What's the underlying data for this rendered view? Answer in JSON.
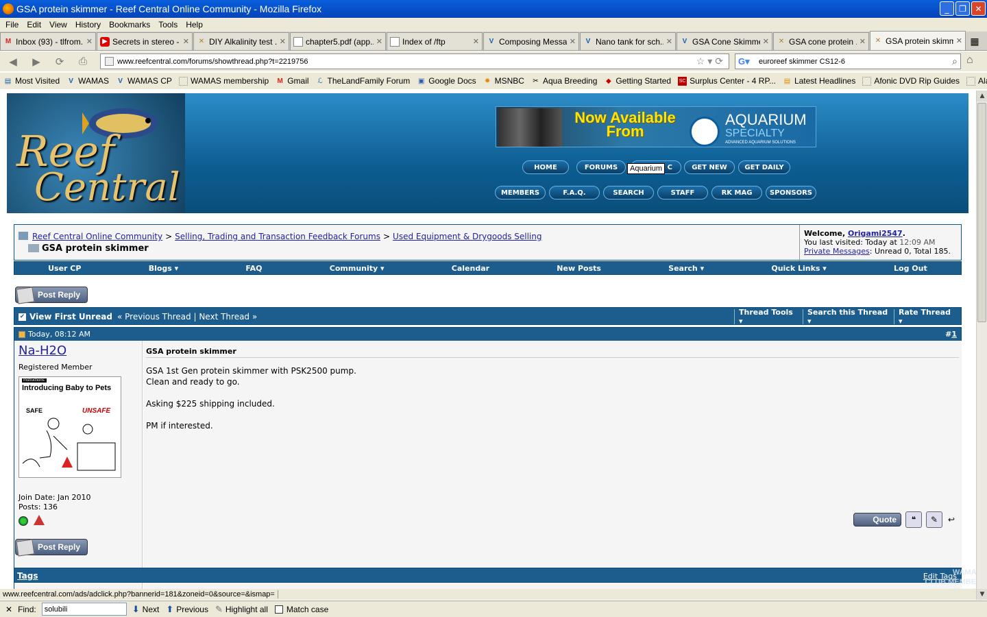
{
  "window": {
    "title": "GSA protein skimmer - Reef Central Online Community - Mozilla Firefox"
  },
  "menu": [
    "File",
    "Edit",
    "View",
    "History",
    "Bookmarks",
    "Tools",
    "Help"
  ],
  "tabs": [
    {
      "label": "Inbox (93) - tlfrom...",
      "icon": "gmail-icon"
    },
    {
      "label": "Secrets in stereo - ...",
      "icon": "youtube-icon"
    },
    {
      "label": "DIY Alkalinity test ...",
      "icon": "reefcentral-icon"
    },
    {
      "label": "chapter5.pdf (app...",
      "icon": "page-icon"
    },
    {
      "label": "Index of /ftp",
      "icon": "page-icon"
    },
    {
      "label": "Composing Message",
      "icon": "wamas-icon"
    },
    {
      "label": "Nano tank for sch...",
      "icon": "wamas-icon"
    },
    {
      "label": "GSA Cone Skimme...",
      "icon": "wamas-icon"
    },
    {
      "label": "GSA cone protein ...",
      "icon": "reefcentral-icon"
    },
    {
      "label": "GSA protein skimm...",
      "icon": "reefcentral-icon"
    }
  ],
  "nav": {
    "url": "www.reefcentral.com/forums/showthread.php?t=2219756",
    "search": "euroreef  skimmer CS12-6"
  },
  "bookmarks": [
    {
      "label": "Most Visited"
    },
    {
      "label": "WAMAS"
    },
    {
      "label": "WAMAS CP"
    },
    {
      "label": "WAMAS membership"
    },
    {
      "label": "Gmail"
    },
    {
      "label": "TheLandFamily Forum"
    },
    {
      "label": "Google Docs"
    },
    {
      "label": "MSNBC"
    },
    {
      "label": "Aqua Breeding"
    },
    {
      "label": "Getting Started"
    },
    {
      "label": "Surplus Center - 4 RP..."
    },
    {
      "label": "Latest Headlines"
    },
    {
      "label": "Afonic DVD Rip Guides"
    },
    {
      "label": "Alarms, keyless, start..."
    }
  ],
  "header": {
    "logo_line1": "Reef",
    "logo_line2": "Central",
    "banner": {
      "headline": "Now Available From",
      "brand": "AQUARIUM",
      "brand2": "SPECIALTY",
      "tagline": "ADVANCED AQUARIUM SOLUTIONS"
    },
    "buttons_row1": [
      "HOME",
      "FORUMS",
      "C",
      "GET NEW",
      "GET DAILY"
    ],
    "buttons_row2": [
      "MEMBERS",
      "F.A.Q.",
      "SEARCH",
      "STAFF",
      "RK MAG",
      "SPONSORS"
    ],
    "tooltip": "Aquarium"
  },
  "breadcrumb": {
    "items": [
      "Reef Central Online Community",
      "Selling, Trading and Transaction Feedback Forums",
      "Used Equipment & Drygoods Selling"
    ],
    "sep": ">",
    "thread_title": "GSA protein skimmer"
  },
  "welcome": {
    "prefix": "Welcome,",
    "user": "Origami2547",
    "last_visit_prefix": "You last visited: Today at",
    "last_visit_time": "12:09 AM",
    "pm_link": "Private Messages",
    "pm_status": ": Unread 0, Total 185."
  },
  "navrow": [
    "User CP",
    "Blogs ▾",
    "FAQ",
    "Community ▾",
    "Calendar",
    "New Posts",
    "Search ▾",
    "Quick Links ▾",
    "Log Out"
  ],
  "post_reply": "Post Reply",
  "thread_bar": {
    "view_first_unread": "View First Unread",
    "prev_next": "« Previous Thread | Next Thread »",
    "tools": [
      "Thread Tools ▾",
      "Search this Thread ▾",
      "Rate Thread ▾"
    ]
  },
  "post": {
    "date": "Today, 08:12 AM",
    "number": "1",
    "number_prefix": "#",
    "username": "Na-H2O",
    "user_title": "Registered Member",
    "avatar": {
      "label": "Instructions:",
      "title": "Introducing Baby to Pets",
      "safe": "SAFE",
      "unsafe": "UNSAFE"
    },
    "join_date": "Join Date: Jan 2010",
    "posts": "Posts: 136",
    "title": "GSA protein skimmer",
    "body": "GSA 1st Gen protein skimmer with PSK2500 pump.\nClean and ready to go.\n\nAsking $225 shipping included.\n\nPM if interested.",
    "quote": "Quote"
  },
  "tags": {
    "label": "Tags",
    "edit": "Edit Tags"
  },
  "watermark": "WAMAS\nCLUB MEMBER\nIMAGES",
  "status": "www.reefcentral.com/ads/adclick.php?bannerid=181&zoneid=0&source=&ismap=",
  "find": {
    "label": "Find:",
    "value": "solubili",
    "next": "Next",
    "previous": "Previous",
    "highlight": "Highlight all",
    "match": "Match case"
  }
}
